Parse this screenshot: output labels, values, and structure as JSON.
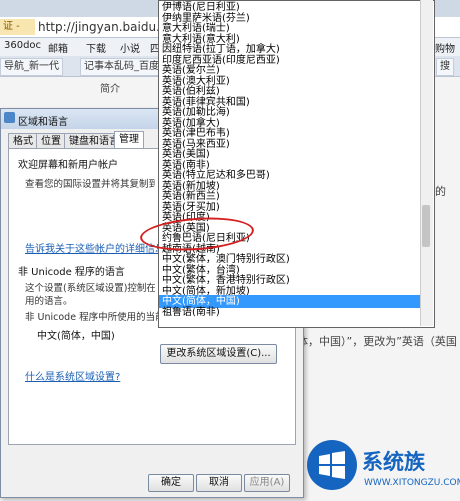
{
  "browser": {
    "secure_label": "证 -",
    "url": "http://jingyan.baidu.com/a",
    "bookmarks": [
      "360doc",
      "邮箱",
      "下载",
      "小说",
      "四",
      "购物"
    ],
    "tabs": [
      "导航_新一代",
      "记事本乱码_百度",
      "搜"
    ]
  },
  "page": {
    "side_link": "简介",
    "text_right_1": "体，中国）”，更改为”英语（英国",
    "text_right_2": "的"
  },
  "dialog": {
    "title": "区域和语言",
    "tabs": [
      "格式",
      "位置",
      "键盘和语言",
      "管理"
    ],
    "welcome_heading": "欢迎屏幕和新用户帐户",
    "welcome_desc": "查看您的国际设置并将其复制到欢迎屏幕",
    "welcome_link": "告诉我关于这些帐户的详细信息",
    "unicode_heading": "非 Unicode 程序的语言",
    "unicode_desc_1": "这个设置(系统区域设置)控制在不支持 Unicode",
    "unicode_desc_2": "用的语言。",
    "current_lang_label": "非 Unicode 程序中所使用的当前语言",
    "current_lang": "中文(简体，中国)",
    "change_locale_btn": "更改系统区域设置(C)...",
    "whatis_link": "什么是系统区域设置?",
    "ok_btn": "确定",
    "cancel_btn": "取消",
    "apply_btn": "应用(A)"
  },
  "dropdown": {
    "options": [
      "伊博语(尼日利亚)",
      "伊纳里萨米语(芬兰)",
      "意大利语(瑞士)",
      "意大利语(意大利)",
      "因纽特语(拉丁语，加拿大)",
      "印度尼西亚语(印度尼西亚)",
      "英语(爱尔兰)",
      "英语(澳大利亚)",
      "英语(伯利兹)",
      "英语(菲律宾共和国)",
      "英语(加勒比海)",
      "英语(加拿大)",
      "英语(津巴布韦)",
      "英语(马来西亚)",
      "英语(美国)",
      "英语(南非)",
      "英语(特立尼达和多巴哥)",
      "英语(新加坡)",
      "英语(新西兰)",
      "英语(牙买加)",
      "英语(印度)",
      "英语(英国)",
      "约鲁巴语(尼日利亚)",
      "越南语(越南)",
      "中文(繁体，澳门特别行政区)",
      "中文(繁体，台湾)",
      "中文(繁体，香港特别行政区)",
      "中文(简体，新加坡)",
      "中文(简体，中国)",
      "祖鲁语(南非)"
    ],
    "selected_index": 28
  },
  "watermark": {
    "text": "系统族",
    "url": "WWW.XITONGZU.COM"
  },
  "colors": {
    "selection": "#3399ff",
    "annotation": "#d42020",
    "brand": "#1565c0"
  }
}
